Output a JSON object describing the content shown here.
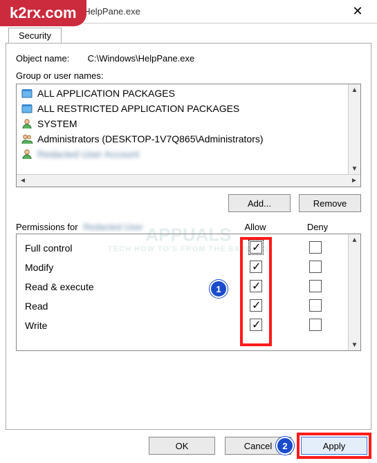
{
  "watermark_banner": "k2rx.com",
  "bg_watermark_line1": "APPUALS",
  "bg_watermark_line2": "TECH HOW TO'S FROM THE EXPERTS",
  "window": {
    "title": "Permissions for HelpPane.exe"
  },
  "tab": {
    "security_label": "Security"
  },
  "object_name": {
    "label": "Object name:",
    "value": "C:\\Windows\\HelpPane.exe"
  },
  "groups": {
    "label": "Group or user names:",
    "items": [
      {
        "icon": "package",
        "label": "ALL APPLICATION PACKAGES"
      },
      {
        "icon": "package",
        "label": "ALL RESTRICTED APPLICATION PACKAGES"
      },
      {
        "icon": "user",
        "label": "SYSTEM"
      },
      {
        "icon": "users",
        "label": "Administrators (DESKTOP-1V7Q865\\Administrators)"
      },
      {
        "icon": "user",
        "label": "Redacted User Account",
        "blurred": true
      }
    ]
  },
  "buttons": {
    "add": "Add...",
    "remove": "Remove",
    "ok": "OK",
    "cancel": "Cancel",
    "apply": "Apply"
  },
  "permissions": {
    "label_prefix": "Permissions for",
    "for_user_blurred": "Redacted User",
    "col_allow": "Allow",
    "col_deny": "Deny",
    "rows": [
      {
        "name": "Full control",
        "allow": true,
        "deny": false,
        "focused": true
      },
      {
        "name": "Modify",
        "allow": true,
        "deny": false
      },
      {
        "name": "Read & execute",
        "allow": true,
        "deny": false
      },
      {
        "name": "Read",
        "allow": true,
        "deny": false
      },
      {
        "name": "Write",
        "allow": true,
        "deny": false
      }
    ]
  },
  "annotations": {
    "badge1": "1",
    "badge2": "2"
  }
}
